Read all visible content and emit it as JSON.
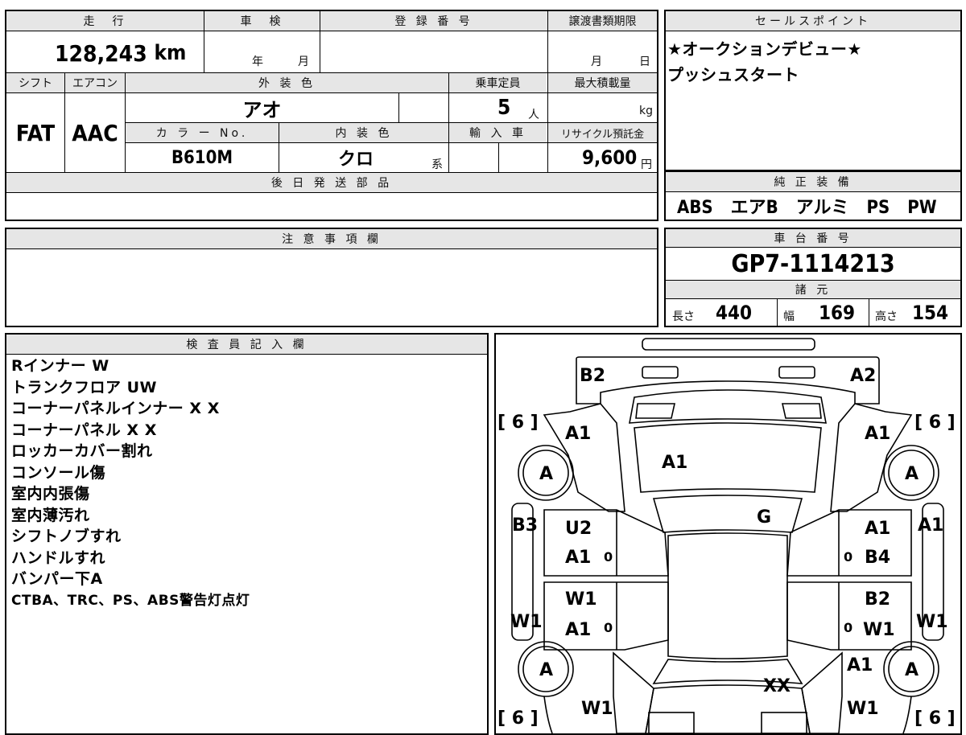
{
  "vehicle": {
    "mileage_label": "走　行",
    "mileage": "128,243",
    "mileage_unit": "km",
    "inspection_label": "車　検",
    "inspection_year_unit": "年",
    "inspection_month_unit": "月",
    "registration_label": "登 録 番 号",
    "transfer_label": "譲渡書類期限",
    "transfer_month_unit": "月",
    "transfer_day_unit": "日",
    "shift_label": "シフト",
    "shift": "FAT",
    "ac_label": "エアコン",
    "ac": "AAC",
    "exterior_color_label": "外 装 色",
    "exterior_color": "アオ",
    "capacity_label": "乗車定員",
    "capacity": "5",
    "capacity_unit": "人",
    "max_load_label": "最大積載量",
    "max_load_unit": "kg",
    "color_no_label": "カ ラ ー No.",
    "color_no": "B610M",
    "interior_color_label": "内 装 色",
    "interior_color": "クロ",
    "interior_color_suffix": "系",
    "import_label": "輸 入 車",
    "recycle_label": "リサイクル預託金",
    "recycle_fee": "9,600",
    "recycle_unit": "円",
    "later_parts_label": "後 日 発 送 部 品"
  },
  "sales": {
    "label": "セールスポイント",
    "lines": [
      "★オークションデビュー★",
      "プッシュスタート"
    ]
  },
  "equipment": {
    "label": "純 正 装 備",
    "value": "ABS　エアB　アルミ　PS　PW"
  },
  "caution": {
    "label": "注 意 事 項 欄"
  },
  "chassis": {
    "label": "車 台 番 号",
    "number": "GP7-1114213"
  },
  "specs": {
    "label": "諸 元",
    "length_label": "長さ",
    "length": "440",
    "width_label": "幅",
    "width": "169",
    "height_label": "高さ",
    "height": "154"
  },
  "inspector": {
    "label": "検 査 員 記 入 欄",
    "notes": [
      "Rインナー W",
      "トランクフロア UW",
      "コーナーパネルインナー X X",
      "コーナーパネル X X",
      "ロッカーカバー割れ",
      "コンソール傷",
      "室内内張傷",
      "室内薄汚れ",
      "シフトノブすれ",
      "ハンドルすれ",
      "バンパー下A",
      "CTBA、TRC、PS、ABS警告灯点灯"
    ]
  },
  "diagram": {
    "tire_grade_left_top": "[ 6 ]",
    "tire_grade_right_top": "[ 6 ]",
    "tire_grade_left_bottom": "[ 6 ]",
    "tire_grade_right_bottom": "[ 6 ]",
    "marks": {
      "rear_left": "B2",
      "rear_right": "A2",
      "fender_rl": "A1",
      "fender_rr": "A1",
      "trunk": "A1",
      "wheel": "A",
      "roof": "G",
      "pillar_left": "B3",
      "door_rl": "U2",
      "door_rl2": "A1",
      "door_rr": "A1",
      "door_rr2": "B4",
      "pillar_right": "A1",
      "door_fl": "W1",
      "door_fl2": "A1",
      "door_fr": "B2",
      "door_fr2": "W1",
      "side_left": "W1",
      "side_right": "W1",
      "fender_fr": "A1",
      "hood": "XX",
      "front_left": "W1",
      "front_right": "W1",
      "zero": "0"
    }
  }
}
